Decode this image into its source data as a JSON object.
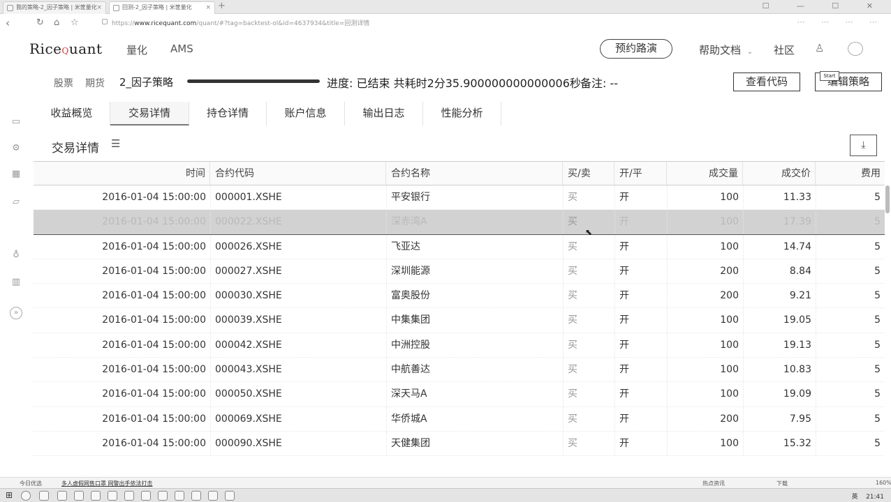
{
  "browser": {
    "tabs": [
      {
        "title": "我的策略-2_因子策略 | 米筐量化"
      },
      {
        "title": "回测-2_因子策略 | 米筐量化"
      }
    ],
    "new_tab": "+",
    "url_prefix": "https://",
    "url_host": "www.ricequant.com",
    "url_path": "/quant/#?tag=backtest-ol&id=4637934&title=回测详情"
  },
  "header": {
    "logo_left": "Rice",
    "logo_right": "uant",
    "nav": [
      "量化",
      "AMS"
    ],
    "demo_button": "预约路演",
    "help_docs": "帮助文档",
    "community": "社区"
  },
  "strategy_bar": {
    "sub_tabs": [
      "股票",
      "期货"
    ],
    "name": "2_因子策略",
    "progress": 1.0,
    "progress_text": "进度: 已结束 共耗时2分35.900000000000006秒",
    "note": "备注: --",
    "view_code_button": "查看代码",
    "edit_strategy_button": "编辑策略",
    "tooltip": "Start"
  },
  "page_tabs": [
    "收益概览",
    "交易详情",
    "持仓详情",
    "账户信息",
    "输出日志",
    "性能分析"
  ],
  "active_tab": "交易详情",
  "section": {
    "title": "交易详情"
  },
  "table": {
    "columns": [
      "时间",
      "合约代码",
      "合约名称",
      "买/卖",
      "开/平",
      "成交量",
      "成交价",
      "费用"
    ],
    "rows": [
      [
        "2016-01-04 15:00:00",
        "000001.XSHE",
        "平安银行",
        "买",
        "开",
        "100",
        "11.33",
        "5"
      ],
      [
        "2016-01-04 15:00:00",
        "000022.XSHE",
        "深赤湾A",
        "买",
        "开",
        "100",
        "17.39",
        "5"
      ],
      [
        "2016-01-04 15:00:00",
        "000026.XSHE",
        "飞亚达",
        "买",
        "开",
        "100",
        "14.74",
        "5"
      ],
      [
        "2016-01-04 15:00:00",
        "000027.XSHE",
        "深圳能源",
        "买",
        "开",
        "200",
        "8.84",
        "5"
      ],
      [
        "2016-01-04 15:00:00",
        "000030.XSHE",
        "富奥股份",
        "买",
        "开",
        "200",
        "9.21",
        "5"
      ],
      [
        "2016-01-04 15:00:00",
        "000039.XSHE",
        "中集集团",
        "买",
        "开",
        "100",
        "19.05",
        "5"
      ],
      [
        "2016-01-04 15:00:00",
        "000042.XSHE",
        "中洲控股",
        "买",
        "开",
        "100",
        "19.13",
        "5"
      ],
      [
        "2016-01-04 15:00:00",
        "000043.XSHE",
        "中航善达",
        "买",
        "开",
        "100",
        "10.83",
        "5"
      ],
      [
        "2016-01-04 15:00:00",
        "000050.XSHE",
        "深天马A",
        "买",
        "开",
        "100",
        "19.09",
        "5"
      ],
      [
        "2016-01-04 15:00:00",
        "000069.XSHE",
        "华侨城A",
        "买",
        "开",
        "200",
        "7.95",
        "5"
      ],
      [
        "2016-01-04 15:00:00",
        "000090.XSHE",
        "天健集团",
        "买",
        "开",
        "100",
        "15.32",
        "5"
      ]
    ],
    "selected_row": 1
  },
  "statusbar": {
    "left": "今日优选",
    "news": "多人虚假网售口罩 网警出手依法打击",
    "right_items": [
      "热点资讯",
      "下载",
      "160%"
    ]
  },
  "taskbar": {
    "clock": "21:41",
    "ime": "英"
  }
}
